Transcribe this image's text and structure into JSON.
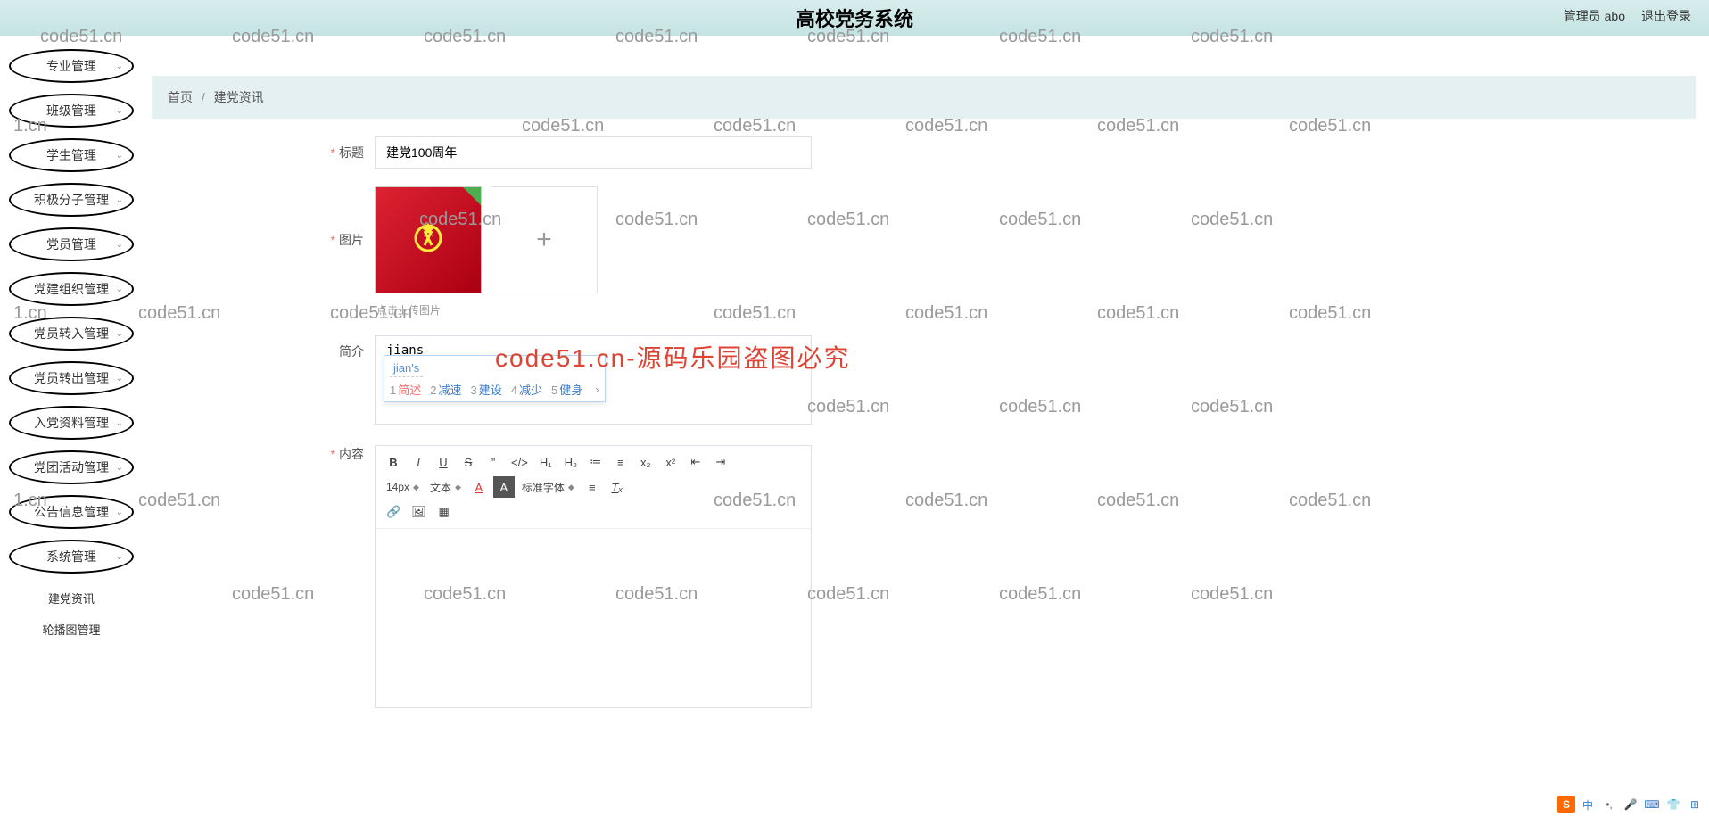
{
  "header": {
    "title": "高校党务系统",
    "admin_label": "管理员 abo",
    "logout_label": "退出登录"
  },
  "sidebar": {
    "items": [
      {
        "label": "专业管理",
        "expandable": true
      },
      {
        "label": "班级管理",
        "expandable": true
      },
      {
        "label": "学生管理",
        "expandable": true
      },
      {
        "label": "积极分子管理",
        "expandable": true
      },
      {
        "label": "党员管理",
        "expandable": true
      },
      {
        "label": "党建组织管理",
        "expandable": true
      },
      {
        "label": "党员转入管理",
        "expandable": true
      },
      {
        "label": "党员转出管理",
        "expandable": true
      },
      {
        "label": "入党资料管理",
        "expandable": true
      },
      {
        "label": "党团活动管理",
        "expandable": true
      },
      {
        "label": "公告信息管理",
        "expandable": true
      },
      {
        "label": "系统管理",
        "expandable": true
      }
    ],
    "sub_items": [
      {
        "label": "建党资讯"
      },
      {
        "label": "轮播图管理"
      }
    ]
  },
  "breadcrumb": {
    "home": "首页",
    "current": "建党资讯",
    "sep": "/"
  },
  "form": {
    "title_label": "标题",
    "title_value": "建党100周年",
    "image_label": "图片",
    "image_hint": "点击上传图片",
    "intro_label": "简介",
    "intro_value": "jians",
    "content_label": "内容"
  },
  "ime": {
    "raw": "jian's",
    "candidates": [
      {
        "n": "1",
        "t": "简述",
        "sel": true
      },
      {
        "n": "2",
        "t": "减速"
      },
      {
        "n": "3",
        "t": "建设"
      },
      {
        "n": "4",
        "t": "减少"
      },
      {
        "n": "5",
        "t": "健身"
      }
    ],
    "more": "›"
  },
  "editor": {
    "font_size": "14px",
    "font_type": "文本",
    "font_family": "标准字体",
    "btns_row1": [
      "B",
      "I",
      "U",
      "S",
      "”",
      "</>",
      "H₁",
      "H₂",
      "≔",
      "≡",
      "x₂",
      "x²",
      "⇤",
      "⇥"
    ],
    "btns_row3": [
      "🔗",
      "🖼",
      "▦"
    ]
  },
  "watermark_text": "code51.cn",
  "big_watermark": "code51.cn-源码乐园盗图必究",
  "tray": {
    "s": "S",
    "zh": "中"
  }
}
